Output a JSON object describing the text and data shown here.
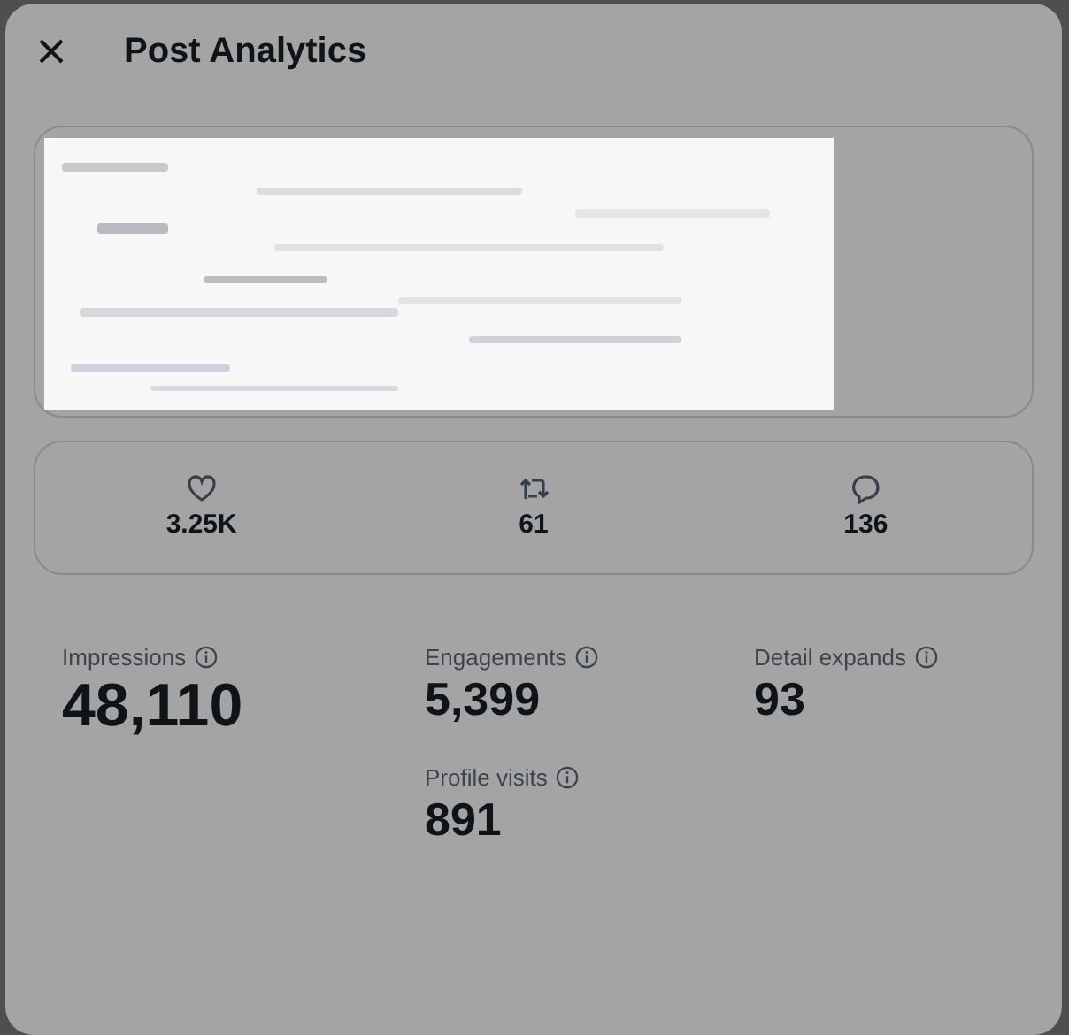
{
  "dialog": {
    "title": "Post Analytics"
  },
  "engagement_counts": [
    {
      "kind": "likes",
      "value": "3.25K"
    },
    {
      "kind": "reposts",
      "value": "61"
    },
    {
      "kind": "replies",
      "value": "136"
    }
  ],
  "metrics": [
    {
      "kind": "primary",
      "label": "Impressions",
      "value": "48,110"
    },
    {
      "kind": "secondary",
      "label": "Engagements",
      "value": "5,399"
    },
    {
      "kind": "secondary",
      "label": "Detail expands",
      "value": "93"
    },
    {
      "kind": "secondary",
      "label": "Profile visits",
      "value": "891"
    }
  ]
}
